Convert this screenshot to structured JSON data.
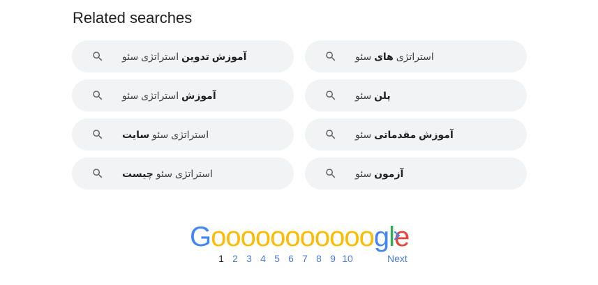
{
  "related": {
    "title": "Related searches",
    "items": [
      {
        "prefix": "",
        "bold": "آموزش تدوین",
        "suffix": " استراتژی سئو"
      },
      {
        "prefix": "استراتژی ",
        "bold": "های",
        "suffix": " سئو"
      },
      {
        "prefix": "",
        "bold": "آموزش",
        "suffix": " استراتژی سئو"
      },
      {
        "prefix": "",
        "bold": "پلن",
        "suffix": " سئو"
      },
      {
        "prefix": "استراتژی سئو ",
        "bold": "سایت",
        "suffix": ""
      },
      {
        "prefix": "",
        "bold": "آموزش مقدماتی",
        "suffix": " سئو"
      },
      {
        "prefix": "استراتژی سئو ",
        "bold": "چیست",
        "suffix": ""
      },
      {
        "prefix": "",
        "bold": "آزمون",
        "suffix": " سئو"
      }
    ]
  },
  "pagination": {
    "logo_letters": [
      "G",
      "o",
      "o",
      "o",
      "o",
      "o",
      "o",
      "o",
      "o",
      "o",
      "o",
      "o",
      "g",
      "l",
      "e"
    ],
    "logo_colors": [
      "#4285f4",
      "#fbbc05",
      "#fbbc05",
      "#fbbc05",
      "#fbbc05",
      "#fbbc05",
      "#fbbc05",
      "#fbbc05",
      "#fbbc05",
      "#fbbc05",
      "#fbbc05",
      "#fbbc05",
      "#4285f4",
      "#34a853",
      "#ea4335"
    ],
    "pages": [
      "1",
      "2",
      "3",
      "4",
      "5",
      "6",
      "7",
      "8",
      "9",
      "10"
    ],
    "current_page": "1",
    "next_label": "Next",
    "link_color": "#4d7cd8"
  },
  "icons": {
    "search": "search-icon",
    "next": "chevron-right-icon"
  }
}
